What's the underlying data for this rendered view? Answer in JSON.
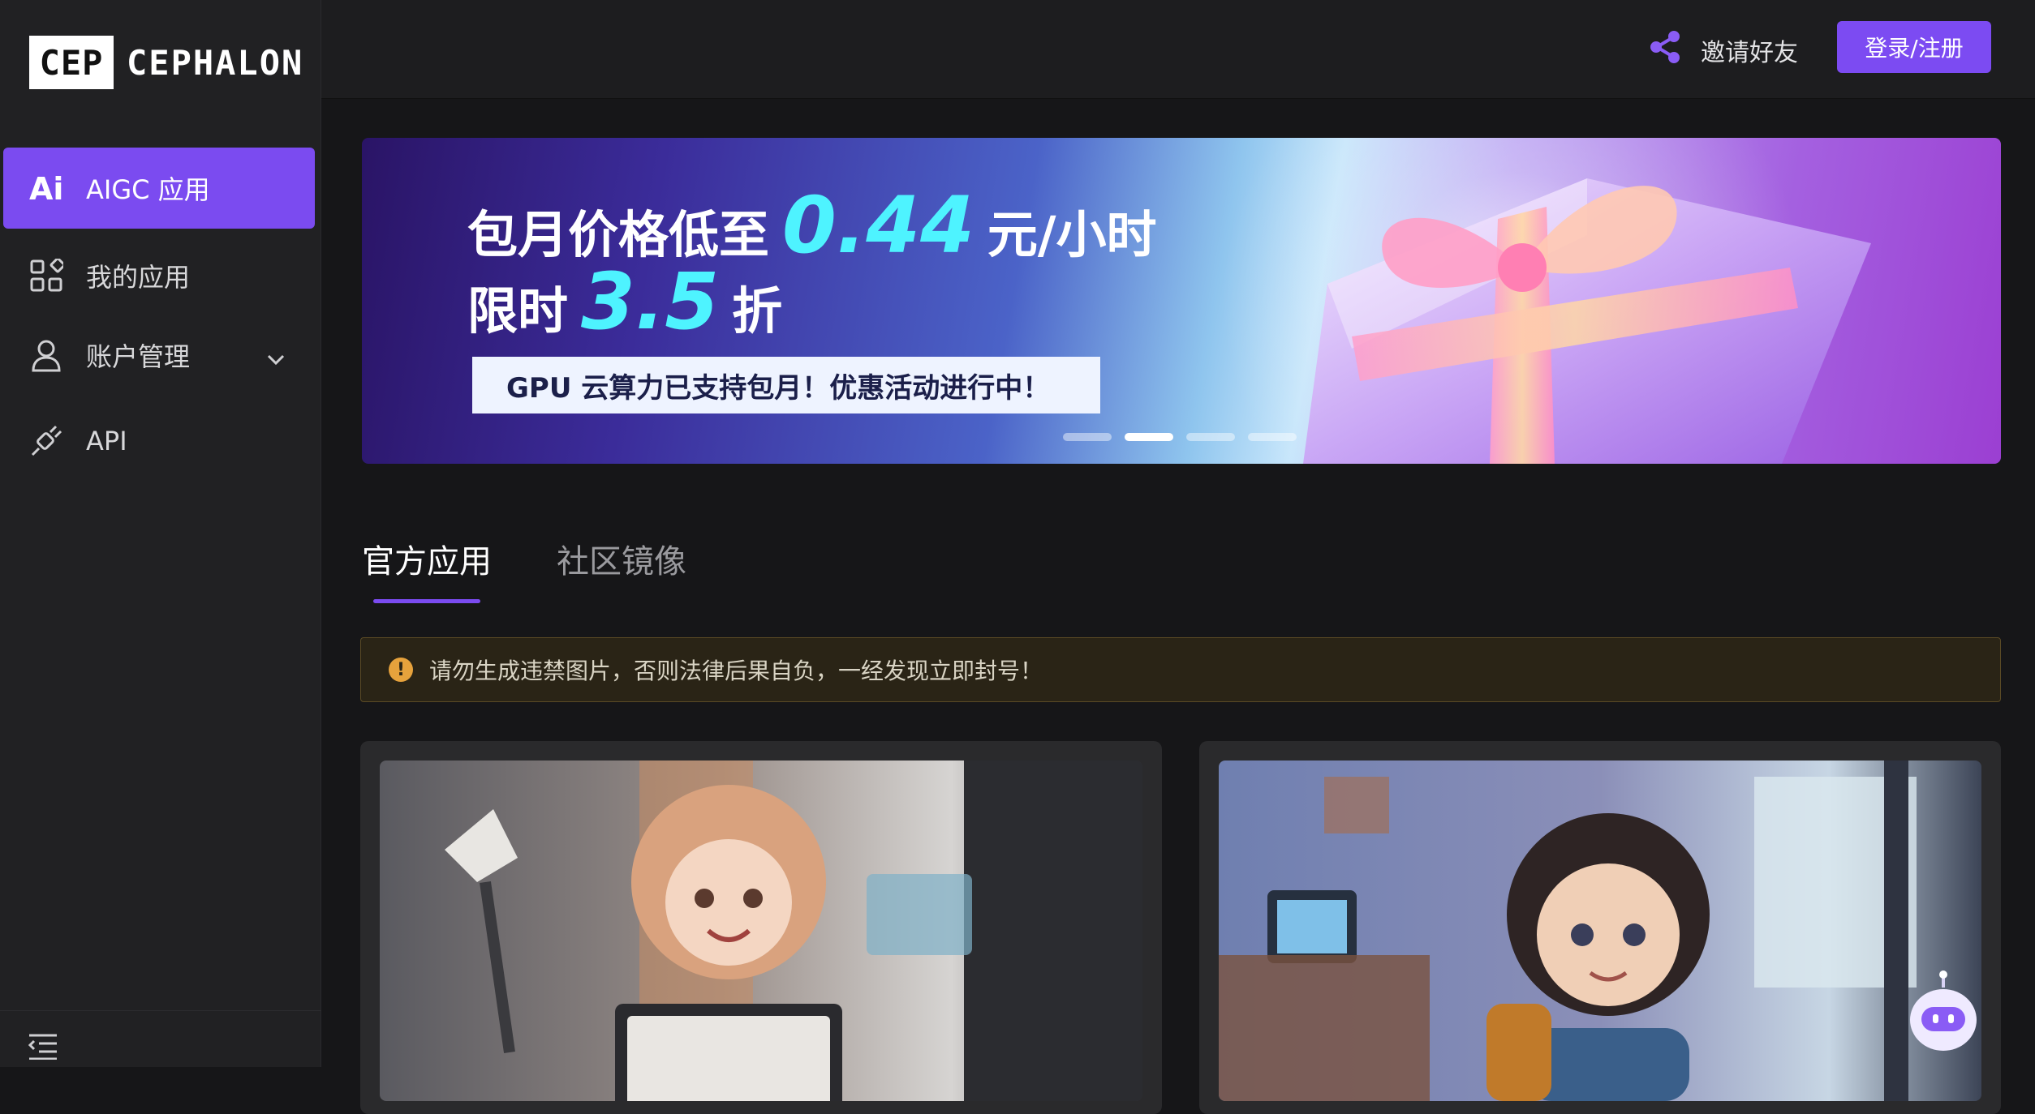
{
  "brand": {
    "logo_mark": "CEP",
    "logo_text": "CEPHALON"
  },
  "sidebar": {
    "items": [
      {
        "label": "AIGC 应用",
        "icon": "ai-icon",
        "active": true
      },
      {
        "label": "我的应用",
        "icon": "apps-grid-icon",
        "active": false
      },
      {
        "label": "账户管理",
        "icon": "user-icon",
        "active": false,
        "has_submenu": true
      },
      {
        "label": "API",
        "icon": "plug-icon",
        "active": false
      }
    ],
    "footer_icon": "collapse-menu-icon"
  },
  "header": {
    "invite_label": "邀请好友",
    "invite_icon": "share-icon",
    "login_label": "登录/注册"
  },
  "banner": {
    "line1_prefix": "包月价格低至",
    "line1_number": "0.44",
    "line1_suffix": "元/小时",
    "line2_prefix": "限时",
    "line2_number": "3.5",
    "line2_suffix": "折",
    "strip_text": "GPU 云算力已支持包月！优惠活动进行中！",
    "slides": 4,
    "active_slide": 2
  },
  "tabs": [
    {
      "label": "官方应用",
      "active": true
    },
    {
      "label": "社区镜像",
      "active": false
    }
  ],
  "notice": {
    "icon": "warning-icon",
    "text": "请勿生成违禁图片，否则法律后果自负，一经发现立即封号！"
  },
  "colors": {
    "accent": "#7b4bf0",
    "sidebar_bg": "#212123",
    "page_bg": "#161618",
    "warning": "#e6a23c"
  }
}
